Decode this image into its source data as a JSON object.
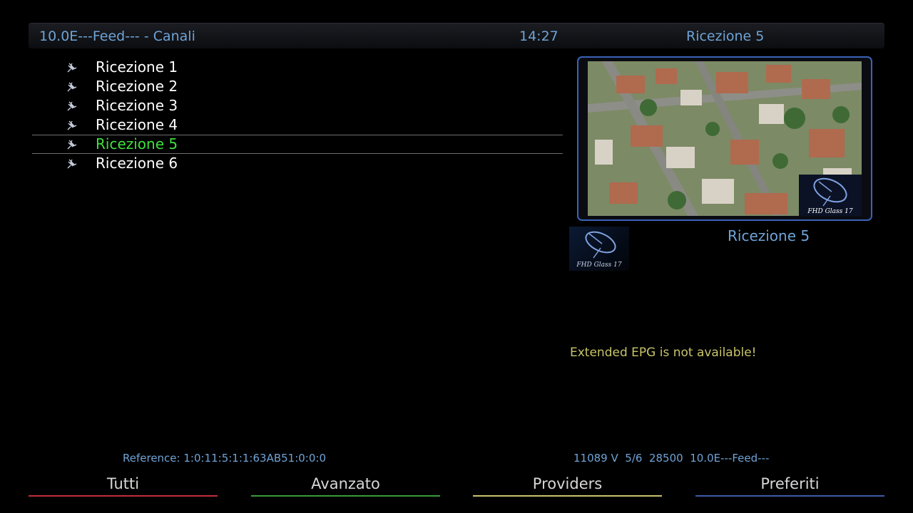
{
  "header": {
    "title": "10.0E---Feed--- - Canali",
    "clock": "14:27",
    "current_channel": "Ricezione 5"
  },
  "channels": [
    {
      "name": "Ricezione 1",
      "icon": "satellite-icon",
      "selected": false
    },
    {
      "name": "Ricezione 2",
      "icon": "satellite-icon",
      "selected": false
    },
    {
      "name": "Ricezione 3",
      "icon": "satellite-icon",
      "selected": false
    },
    {
      "name": "Ricezione 4",
      "icon": "satellite-icon",
      "selected": false
    },
    {
      "name": "Ricezione 5",
      "icon": "satellite-icon",
      "selected": true
    },
    {
      "name": "Ricezione 6",
      "icon": "satellite-icon",
      "selected": false
    }
  ],
  "preview": {
    "logo_text": "FHD Glass 17"
  },
  "picon": {
    "logo_text": "FHD Glass 17",
    "channel_name": "Ricezione 5"
  },
  "epg": {
    "message": "Extended EPG is not available!"
  },
  "footer": {
    "reference": "Reference: 1:0:11:5:1:1:63AB51:0:0:0",
    "transponder": "11089 V  5/6  28500  10.0E---Feed---"
  },
  "buttons": {
    "red": {
      "label": "Tutti",
      "color": "#c0303a"
    },
    "green": {
      "label": "Avanzato",
      "color": "#3a9a3a"
    },
    "yellow": {
      "label": "Providers",
      "color": "#c8c46a"
    },
    "blue": {
      "label": "Preferiti",
      "color": "#3b5aa8"
    }
  },
  "colors": {
    "accent_text": "#6fa3d6",
    "selected_text": "#3ee03e",
    "frame": "#3b63b8"
  }
}
